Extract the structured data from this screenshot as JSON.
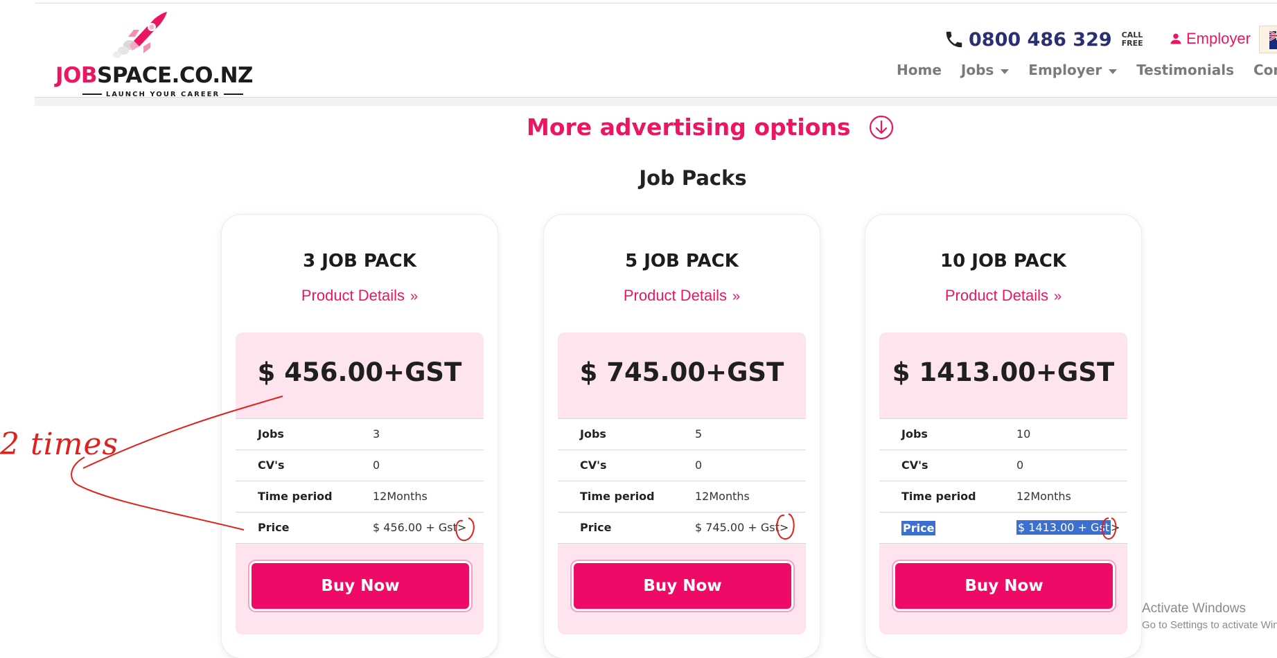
{
  "header": {
    "logo": {
      "brand_pink": "JOB",
      "brand_dark": "SPACE.CO.NZ",
      "tagline": "LAUNCH YOUR CAREER"
    },
    "phone": {
      "number": "0800 486 329",
      "call_free": "CALL FREE"
    },
    "employer_label": "Employer",
    "nav": [
      {
        "label": "Home",
        "dropdown": false
      },
      {
        "label": "Jobs",
        "dropdown": true
      },
      {
        "label": "Employer",
        "dropdown": true
      },
      {
        "label": "Testimonials",
        "dropdown": false
      },
      {
        "label": "Contact Us",
        "dropdown": false
      }
    ]
  },
  "main": {
    "more_options": "More advertising options",
    "section_title": "Job Packs",
    "details_label": "Product Details",
    "buy_label": "Buy Now",
    "row_labels": {
      "jobs": "Jobs",
      "cvs": "CV's",
      "time": "Time period",
      "price": "Price"
    },
    "packs": [
      {
        "title": "3 JOB PACK",
        "price": "$ 456.00+GST",
        "jobs": "3",
        "cvs": "0",
        "time": "12Months",
        "price_row": "$ 456.00 + Gst"
      },
      {
        "title": "5 JOB PACK",
        "price": "$ 745.00+GST",
        "jobs": "5",
        "cvs": "0",
        "time": "12Months",
        "price_row": "$ 745.00 + Gst"
      },
      {
        "title": "10 JOB PACK",
        "price": "$ 1413.00+GST",
        "jobs": "10",
        "cvs": "0",
        "time": "12Months",
        "price_row": "$ 1413.00 + Gst"
      }
    ]
  },
  "annotation": {
    "text": "2 times",
    "color": "#e0201c"
  },
  "watermark": {
    "line1": "Activate Windows",
    "line2": "Go to Settings to activate Windows."
  },
  "colors": {
    "brand_pink": "#ec1561",
    "brand_navy": "#2a2e72",
    "card_body": "#fde4ee",
    "button": "#ef0a68"
  }
}
